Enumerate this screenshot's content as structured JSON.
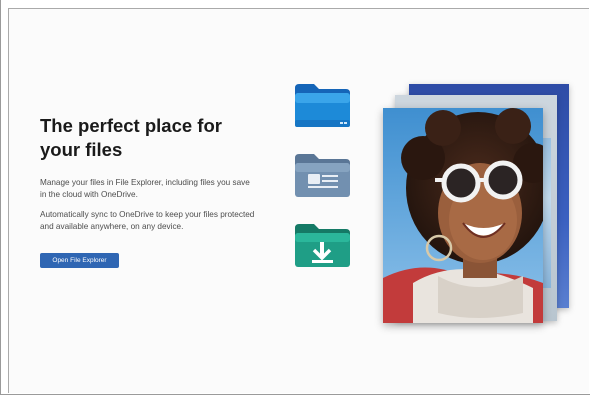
{
  "hero": {
    "title": "The perfect place for your files",
    "description_1": "Manage your files in File Explorer, including files you save in the cloud with OneDrive.",
    "description_2": "Automatically sync to OneDrive to keep your files protected and available anywhere, on any device.",
    "button_label": "Open File Explorer"
  },
  "illustration": {
    "folders": [
      {
        "icon": "blue-folder-icon",
        "color": "#1e88d6"
      },
      {
        "icon": "document-folder-icon",
        "color": "#6f8fb0"
      },
      {
        "icon": "download-folder-icon",
        "color": "#1f9e86"
      }
    ],
    "photo": "woman-with-sunglasses-photo"
  },
  "colors": {
    "accent": "#2f66b3",
    "title_text": "#1a1a1a",
    "body_text": "#4d4d4d"
  }
}
